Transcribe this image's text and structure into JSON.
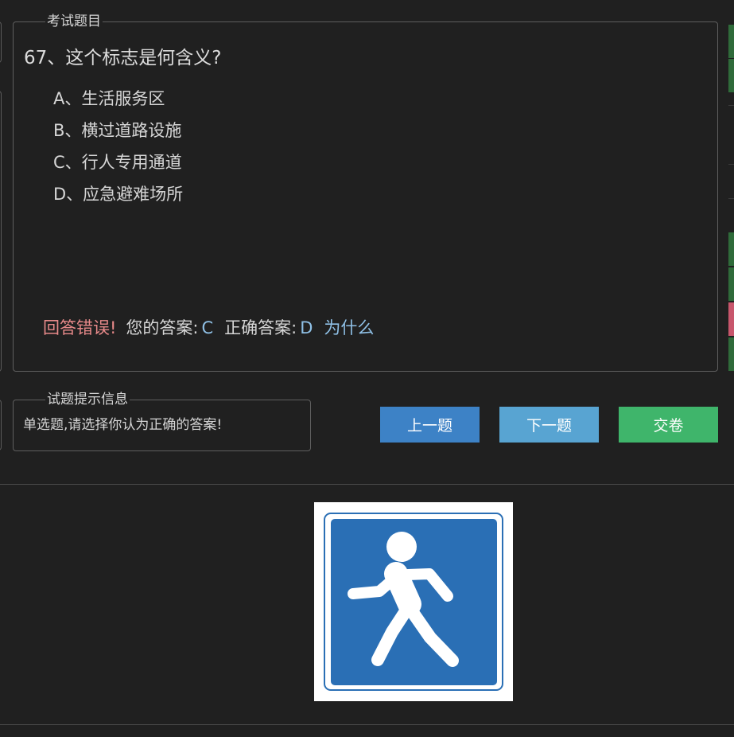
{
  "question_panel": {
    "legend": "考试题目",
    "question": "67、这个标志是何含义?",
    "options": [
      "A、生活服务区",
      "B、横过道路设施",
      "C、行人专用通道",
      "D、应急避难场所"
    ],
    "result": {
      "status": "回答错误!",
      "your_answer_label": "您的答案:",
      "your_answer": "C",
      "correct_answer_label": "正确答案:",
      "correct_answer": "D",
      "why_link": "为什么"
    }
  },
  "hint_panel": {
    "legend": "试题提示信息",
    "text": "单选题,请选择你认为正确的答案!"
  },
  "buttons": {
    "prev": "上一题",
    "next": "下一题",
    "submit": "交卷"
  },
  "sign": {
    "icon": "pedestrian-sign-icon",
    "background_color": "#2a6fb5"
  },
  "colors": {
    "wrong": "#e88a8a",
    "answer": "#8fc0e6",
    "prev_button": "#3d82c6",
    "next_button": "#58a4d2",
    "submit_button": "#3fb56b"
  }
}
